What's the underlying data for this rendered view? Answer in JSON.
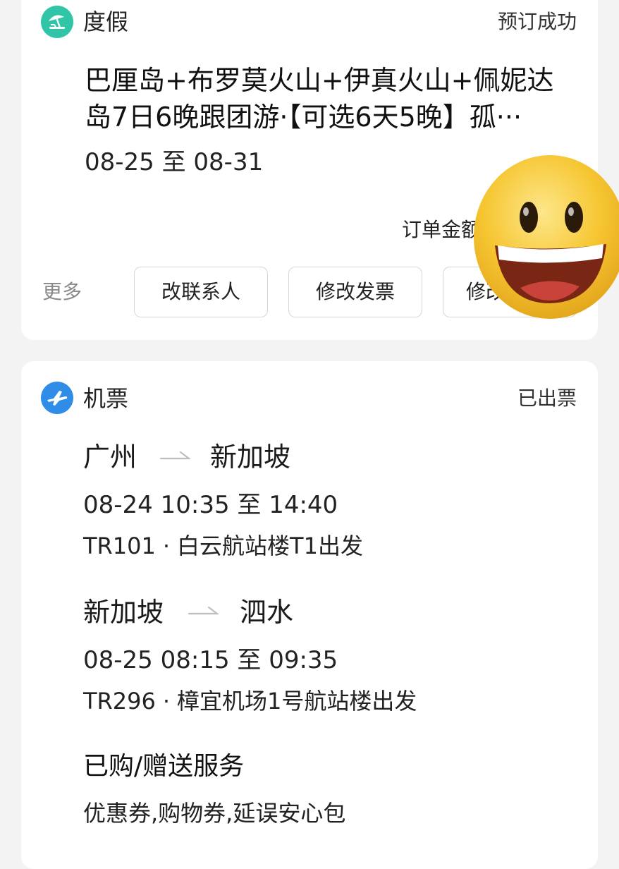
{
  "vacation": {
    "icon": "beach-umbrella-icon",
    "icon_color": "#2fc5a6",
    "category": "度假",
    "status": "预订成功",
    "title_line1": "巴厘岛+布罗莫火山+伊真火山+佩妮达",
    "title_line2": "岛7日6晚跟团游·【可选6天5晚】孤···",
    "dates": "08-25 至 08-31",
    "amount_label": "订单金额",
    "more_label": "更多",
    "buttons": [
      "改联系人",
      "修改发票",
      "修改"
    ]
  },
  "sticker": {
    "icon": "grinning-face-emoji",
    "color": "#f6c631"
  },
  "flight": {
    "icon": "airplane-icon",
    "icon_color": "#2f8de8",
    "category": "机票",
    "status": "已出票",
    "segments": [
      {
        "from": "广州",
        "to": "新加坡",
        "time": "08-24 10:35 至 14:40",
        "flight_no": "TR101",
        "separator": "·",
        "departure": "白云航站楼T1出发"
      },
      {
        "from": "新加坡",
        "to": "泗水",
        "time": "08-25 08:15 至 09:35",
        "flight_no": "TR296",
        "separator": "·",
        "departure": "樟宜机场1号航站楼出发"
      }
    ],
    "services_title": "已购/赠送服务",
    "services": "优惠券,购物券,延误安心包"
  }
}
